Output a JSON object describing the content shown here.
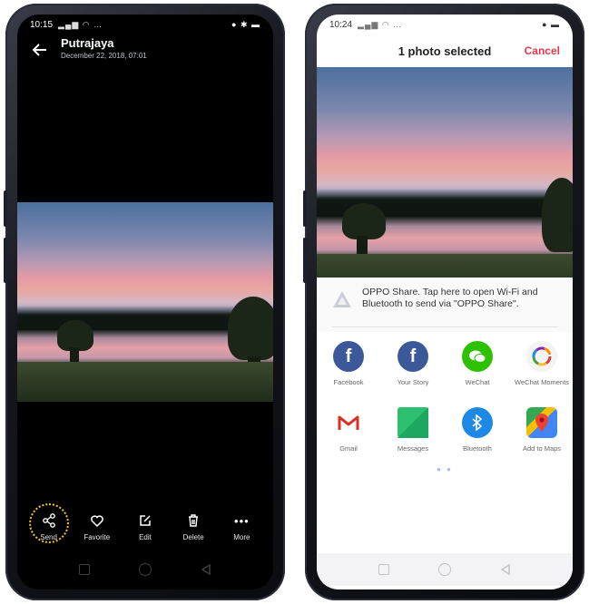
{
  "left_phone": {
    "status": {
      "time": "10:15",
      "sys_icons": "…",
      "right_icons": "● ✱ ▬"
    },
    "header": {
      "title": "Putrajaya",
      "subtitle": "December 22, 2018, 07:01"
    },
    "toolbar": [
      {
        "label": "Send",
        "icon": "share-icon"
      },
      {
        "label": "Favorite",
        "icon": "heart-icon"
      },
      {
        "label": "Edit",
        "icon": "edit-icon"
      },
      {
        "label": "Delete",
        "icon": "trash-icon"
      },
      {
        "label": "More",
        "icon": "more-icon"
      }
    ],
    "colors": {
      "background": "#000000",
      "send_highlight": "#f2c230"
    }
  },
  "right_phone": {
    "status": {
      "time": "10:24",
      "sys_icons": "…",
      "right_icons": "● ▬"
    },
    "header": {
      "title": "1 photo selected",
      "cancel": "Cancel"
    },
    "oppo_share": {
      "text": "OPPO Share. Tap here to open Wi-Fi and Bluetooth to send via \"OPPO Share\".",
      "icon": "oppo-share-icon"
    },
    "apps": [
      {
        "label": "Facebook",
        "icon": "facebook-icon"
      },
      {
        "label": "Your Story",
        "icon": "facebook-story-icon"
      },
      {
        "label": "WeChat",
        "icon": "wechat-icon"
      },
      {
        "label": "WeChat Moments",
        "icon": "wechat-moments-icon"
      },
      {
        "label": "Gmail",
        "icon": "gmail-icon"
      },
      {
        "label": "Messages",
        "icon": "messages-icon"
      },
      {
        "label": "Bluetooth",
        "icon": "bluetooth-icon"
      },
      {
        "label": "Add to Maps",
        "icon": "maps-icon"
      }
    ],
    "pager_dots": "● ●",
    "colors": {
      "accent": "#e7384a",
      "facebook": "#3b5998",
      "wechat": "#2dc100",
      "bluetooth": "#1e88e5"
    }
  }
}
